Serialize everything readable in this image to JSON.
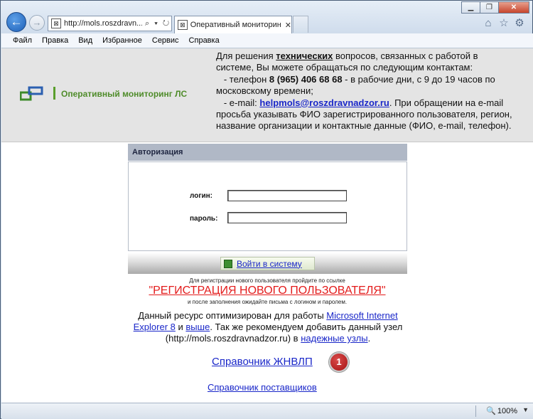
{
  "browser": {
    "address": "http://mols.roszdravn...",
    "address_icons": "⌕ ▾ ↻",
    "tab_title": "Оперативный мониторинг ...",
    "tab_close": "✕",
    "window_buttons": [
      "▁",
      "❐",
      "✕"
    ],
    "tool_icons": [
      "⌂",
      "☆",
      "⚙"
    ]
  },
  "menu": [
    "Файл",
    "Правка",
    "Вид",
    "Избранное",
    "Сервис",
    "Справка"
  ],
  "header": {
    "logo_text": "Оперативный мониторинг ЛС",
    "contact": {
      "intro_before": "Для решения ",
      "intro_bold": "технических",
      "intro_after": " вопросов, связанных с работой в системе, Вы можете обращаться по следующим контактам:",
      "phone_prefix": "   - телефон ",
      "phone": "8 (965) 406 68 68",
      "phone_suffix": " - в рабочие дни, с 9 до 19 часов по московскому времени;",
      "email_prefix": "   - e-mail: ",
      "email": "helpmols@roszdravnadzor.ru",
      "email_suffix": ". При обращении на e-mail просьба указывать ФИО зарегистрированного пользователя, регион, название организации и контактные данные (ФИО, e-mail, телефон)."
    }
  },
  "auth": {
    "title": "Авторизация",
    "login_label": "логин:",
    "password_label": "пароль:",
    "login_value": "",
    "password_value": "",
    "submit_label": "Войти в систему"
  },
  "registration": {
    "note_top": "Для регистрации нового пользователя пройдите по ссылке",
    "link": "\"РЕГИСТРАЦИЯ НОВОГО ПОЛЬЗОВАТЕЛЯ\"",
    "note_bottom": "и после заполнения ожидайте письма с логином и паролем."
  },
  "optimization": {
    "text1": "Данный ресурс оптимизирован для работы ",
    "link1": "Microsoft Internet Explorer 8",
    "text2": " и ",
    "link2": "выше",
    "text3": ". Так же рекомендуем добавить данный узел (http://mols.roszdravnadzor.ru) в ",
    "link3": "надежные узлы",
    "text4": "."
  },
  "links": {
    "sprav_jnvlp": "Справочник ЖНВЛП",
    "badge": "1",
    "sprav_suppliers": "Справочник поставщиков"
  },
  "status": {
    "zoom_icon": "🔍",
    "zoom": "100%",
    "zoom_arrow": "▼"
  }
}
